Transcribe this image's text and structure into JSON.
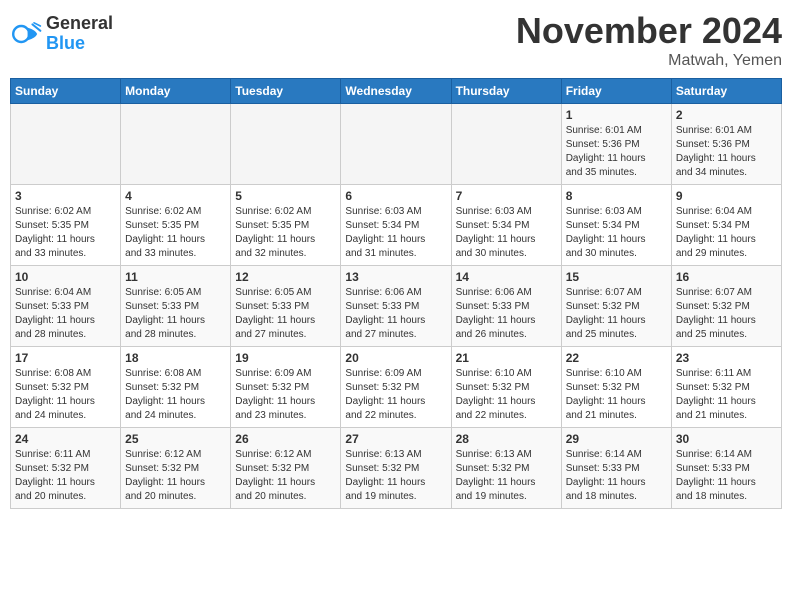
{
  "header": {
    "logo_general": "General",
    "logo_blue": "Blue",
    "month_title": "November 2024",
    "location": "Matwah, Yemen"
  },
  "weekdays": [
    "Sunday",
    "Monday",
    "Tuesday",
    "Wednesday",
    "Thursday",
    "Friday",
    "Saturday"
  ],
  "weeks": [
    [
      {
        "day": "",
        "info": ""
      },
      {
        "day": "",
        "info": ""
      },
      {
        "day": "",
        "info": ""
      },
      {
        "day": "",
        "info": ""
      },
      {
        "day": "",
        "info": ""
      },
      {
        "day": "1",
        "info": "Sunrise: 6:01 AM\nSunset: 5:36 PM\nDaylight: 11 hours\nand 35 minutes."
      },
      {
        "day": "2",
        "info": "Sunrise: 6:01 AM\nSunset: 5:36 PM\nDaylight: 11 hours\nand 34 minutes."
      }
    ],
    [
      {
        "day": "3",
        "info": "Sunrise: 6:02 AM\nSunset: 5:35 PM\nDaylight: 11 hours\nand 33 minutes."
      },
      {
        "day": "4",
        "info": "Sunrise: 6:02 AM\nSunset: 5:35 PM\nDaylight: 11 hours\nand 33 minutes."
      },
      {
        "day": "5",
        "info": "Sunrise: 6:02 AM\nSunset: 5:35 PM\nDaylight: 11 hours\nand 32 minutes."
      },
      {
        "day": "6",
        "info": "Sunrise: 6:03 AM\nSunset: 5:34 PM\nDaylight: 11 hours\nand 31 minutes."
      },
      {
        "day": "7",
        "info": "Sunrise: 6:03 AM\nSunset: 5:34 PM\nDaylight: 11 hours\nand 30 minutes."
      },
      {
        "day": "8",
        "info": "Sunrise: 6:03 AM\nSunset: 5:34 PM\nDaylight: 11 hours\nand 30 minutes."
      },
      {
        "day": "9",
        "info": "Sunrise: 6:04 AM\nSunset: 5:34 PM\nDaylight: 11 hours\nand 29 minutes."
      }
    ],
    [
      {
        "day": "10",
        "info": "Sunrise: 6:04 AM\nSunset: 5:33 PM\nDaylight: 11 hours\nand 28 minutes."
      },
      {
        "day": "11",
        "info": "Sunrise: 6:05 AM\nSunset: 5:33 PM\nDaylight: 11 hours\nand 28 minutes."
      },
      {
        "day": "12",
        "info": "Sunrise: 6:05 AM\nSunset: 5:33 PM\nDaylight: 11 hours\nand 27 minutes."
      },
      {
        "day": "13",
        "info": "Sunrise: 6:06 AM\nSunset: 5:33 PM\nDaylight: 11 hours\nand 27 minutes."
      },
      {
        "day": "14",
        "info": "Sunrise: 6:06 AM\nSunset: 5:33 PM\nDaylight: 11 hours\nand 26 minutes."
      },
      {
        "day": "15",
        "info": "Sunrise: 6:07 AM\nSunset: 5:32 PM\nDaylight: 11 hours\nand 25 minutes."
      },
      {
        "day": "16",
        "info": "Sunrise: 6:07 AM\nSunset: 5:32 PM\nDaylight: 11 hours\nand 25 minutes."
      }
    ],
    [
      {
        "day": "17",
        "info": "Sunrise: 6:08 AM\nSunset: 5:32 PM\nDaylight: 11 hours\nand 24 minutes."
      },
      {
        "day": "18",
        "info": "Sunrise: 6:08 AM\nSunset: 5:32 PM\nDaylight: 11 hours\nand 24 minutes."
      },
      {
        "day": "19",
        "info": "Sunrise: 6:09 AM\nSunset: 5:32 PM\nDaylight: 11 hours\nand 23 minutes."
      },
      {
        "day": "20",
        "info": "Sunrise: 6:09 AM\nSunset: 5:32 PM\nDaylight: 11 hours\nand 22 minutes."
      },
      {
        "day": "21",
        "info": "Sunrise: 6:10 AM\nSunset: 5:32 PM\nDaylight: 11 hours\nand 22 minutes."
      },
      {
        "day": "22",
        "info": "Sunrise: 6:10 AM\nSunset: 5:32 PM\nDaylight: 11 hours\nand 21 minutes."
      },
      {
        "day": "23",
        "info": "Sunrise: 6:11 AM\nSunset: 5:32 PM\nDaylight: 11 hours\nand 21 minutes."
      }
    ],
    [
      {
        "day": "24",
        "info": "Sunrise: 6:11 AM\nSunset: 5:32 PM\nDaylight: 11 hours\nand 20 minutes."
      },
      {
        "day": "25",
        "info": "Sunrise: 6:12 AM\nSunset: 5:32 PM\nDaylight: 11 hours\nand 20 minutes."
      },
      {
        "day": "26",
        "info": "Sunrise: 6:12 AM\nSunset: 5:32 PM\nDaylight: 11 hours\nand 20 minutes."
      },
      {
        "day": "27",
        "info": "Sunrise: 6:13 AM\nSunset: 5:32 PM\nDaylight: 11 hours\nand 19 minutes."
      },
      {
        "day": "28",
        "info": "Sunrise: 6:13 AM\nSunset: 5:32 PM\nDaylight: 11 hours\nand 19 minutes."
      },
      {
        "day": "29",
        "info": "Sunrise: 6:14 AM\nSunset: 5:33 PM\nDaylight: 11 hours\nand 18 minutes."
      },
      {
        "day": "30",
        "info": "Sunrise: 6:14 AM\nSunset: 5:33 PM\nDaylight: 11 hours\nand 18 minutes."
      }
    ]
  ]
}
